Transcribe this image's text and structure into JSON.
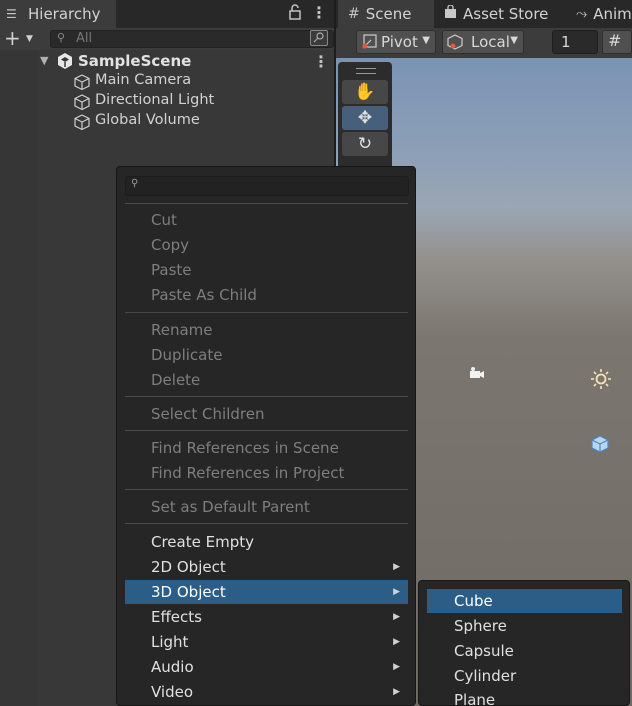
{
  "hierarchy": {
    "tab_label": "Hierarchy",
    "search_placeholder": "All",
    "scene_name": "SampleScene",
    "objects": [
      "Main Camera",
      "Directional Light",
      "Global Volume"
    ]
  },
  "scene_view": {
    "tabs": [
      "Scene",
      "Asset Store",
      "Anim"
    ],
    "pivot_label": "Pivot",
    "space_label": "Local",
    "grid_size": "1"
  },
  "context_menu": {
    "groups": [
      [
        "Cut",
        "Copy",
        "Paste",
        "Paste As Child"
      ],
      [
        "Rename",
        "Duplicate",
        "Delete"
      ],
      [
        "Select Children"
      ],
      [
        "Find References in Scene",
        "Find References in Project"
      ],
      [
        "Set as Default Parent"
      ],
      [
        "Create Empty",
        "2D Object",
        "3D Object",
        "Effects",
        "Light",
        "Audio",
        "Video"
      ]
    ],
    "selected": "3D Object"
  },
  "submenu": {
    "items": [
      "Cube",
      "Sphere",
      "Capsule",
      "Cylinder",
      "Plane"
    ],
    "selected": "Cube"
  },
  "colors": {
    "selection": "#2c5d87",
    "menu_bg": "#262626",
    "panel_bg": "#383838"
  }
}
